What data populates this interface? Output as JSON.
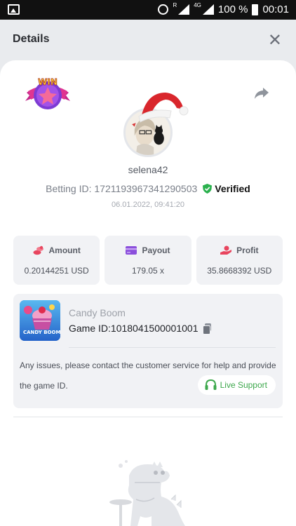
{
  "status_bar": {
    "battery_text": "100 %",
    "time": "00:01",
    "network_label": "4G",
    "roaming_label": "R"
  },
  "header": {
    "title": "Details"
  },
  "profile": {
    "username": "selena42",
    "betting_label": "Betting ID:",
    "betting_id": "1721193967341290503",
    "verified_label": "Verified",
    "timestamp": "06.01.2022, 09:41:20",
    "badge_text": "WIN"
  },
  "stats": [
    {
      "label": "Amount",
      "value": "0.20144251 USD",
      "icon": "coins-icon",
      "color": "#e8455e"
    },
    {
      "label": "Payout",
      "value": "179.05 x",
      "icon": "card-icon",
      "color": "#8b4fdc"
    },
    {
      "label": "Profit",
      "value": "35.8668392 USD",
      "icon": "hand-money-icon",
      "color": "#e8455e"
    }
  ],
  "game": {
    "name": "Candy Boom",
    "id_label": "Game ID:",
    "id_value": "1018041500001001",
    "thumb_text": "CANDY BOOM",
    "issue_text": "Any issues, please contact the customer service for help and provide the game ID.",
    "live_support_label": "Live Support"
  },
  "colors": {
    "accent_green": "#3da84c",
    "verified_green": "#2bb14e"
  }
}
